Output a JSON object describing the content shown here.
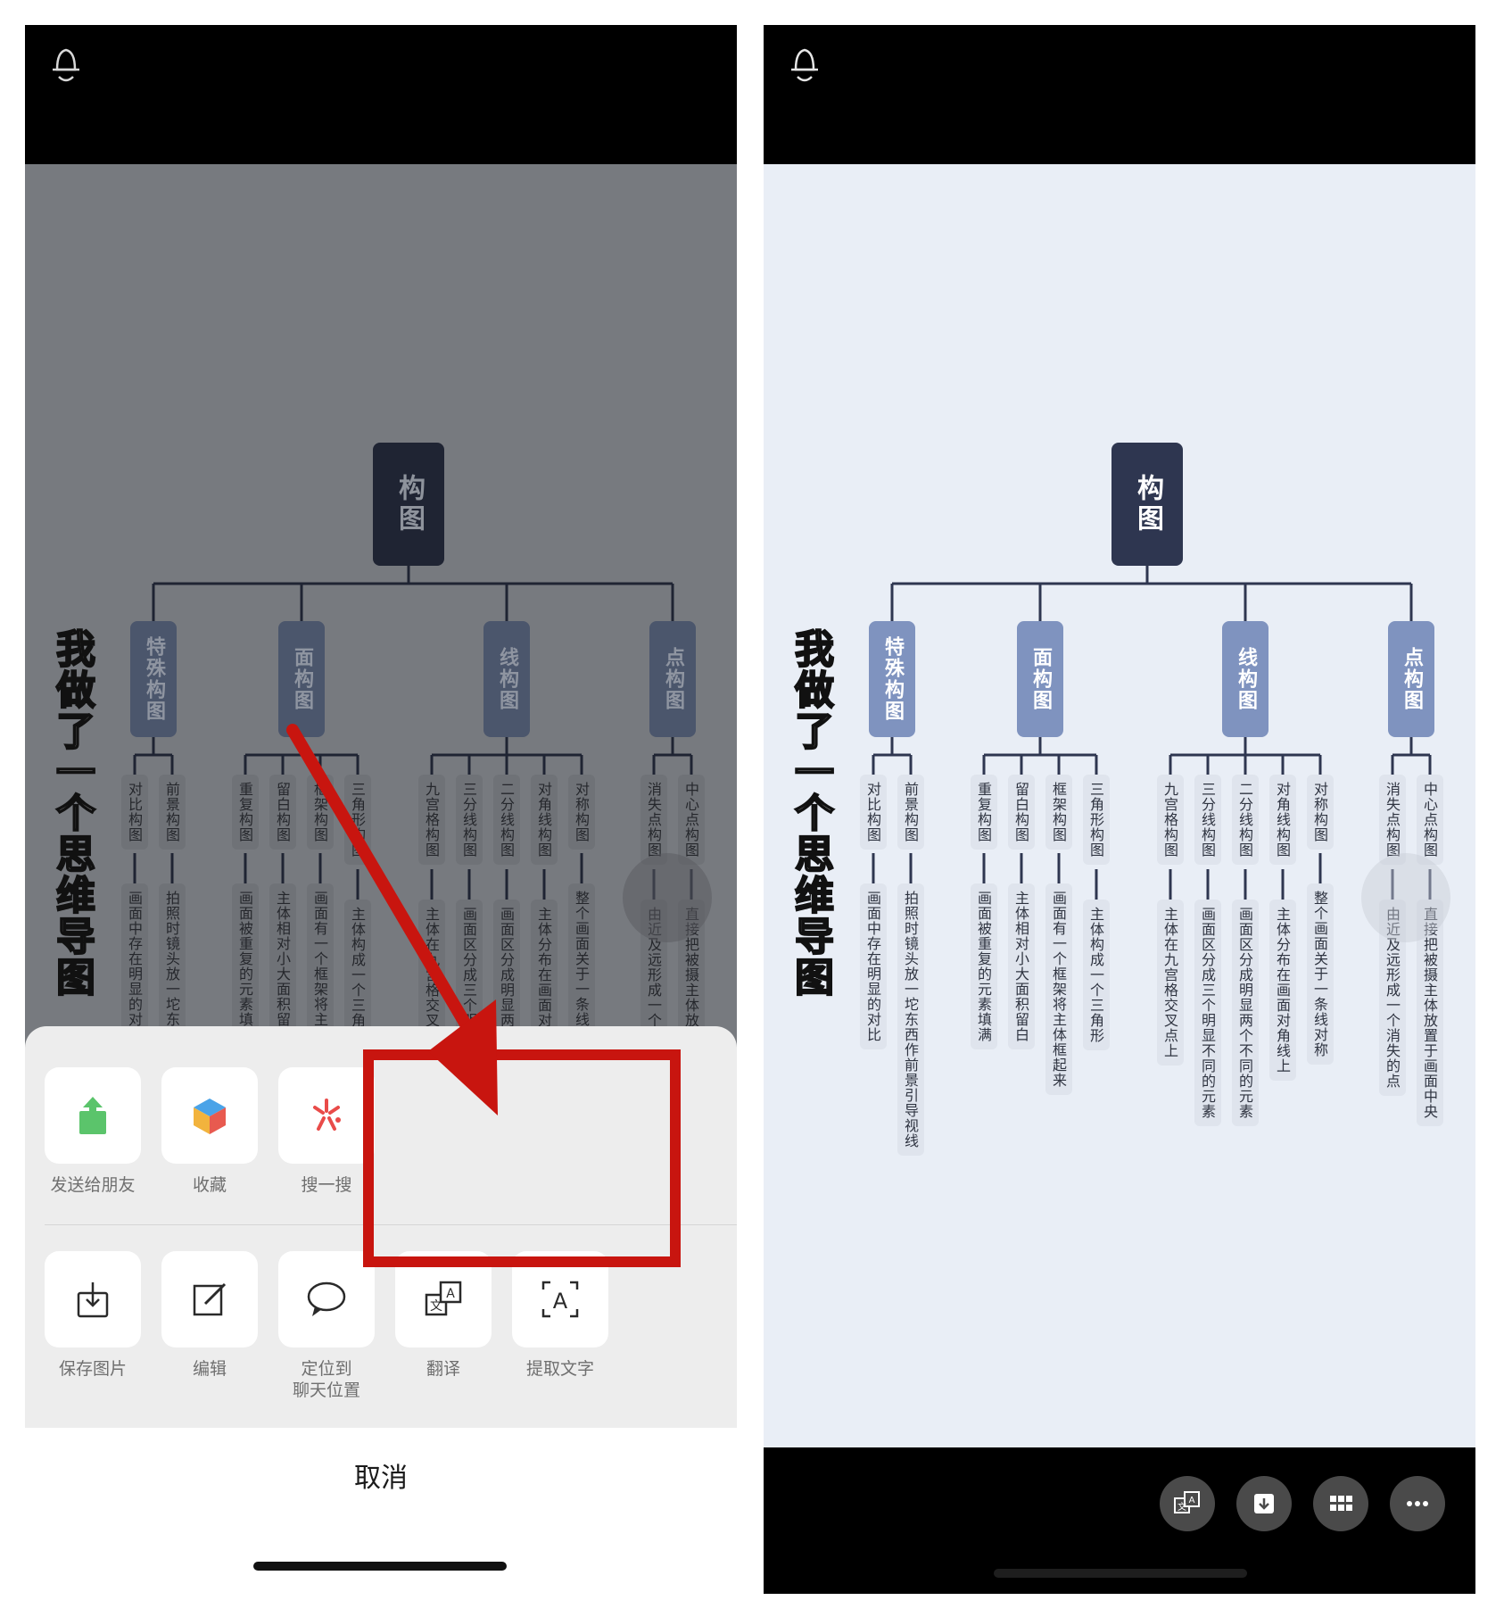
{
  "mindmap": {
    "root": "构图",
    "title": "我做了一个思维导图",
    "branches": [
      {
        "label": "特殊构图",
        "leaves": [
          {
            "label": "对比构图",
            "detail": "画面中存在明显的对比"
          },
          {
            "label": "前景构图",
            "detail": "拍照时镜头放一坨东西作前景引导视线"
          }
        ]
      },
      {
        "label": "面构图",
        "leaves": [
          {
            "label": "重复构图",
            "detail": "画面被重复的元素填满"
          },
          {
            "label": "留白构图",
            "detail": "主体相对小大面积留白"
          },
          {
            "label": "框架构图",
            "detail": "画面有一个框架将主体框起来"
          },
          {
            "label": "三角形构图",
            "detail": "主体构成一个三角形"
          }
        ]
      },
      {
        "label": "线构图",
        "leaves": [
          {
            "label": "九宫格构图",
            "detail": "主体在九宫格交叉点上"
          },
          {
            "label": "三分线构图",
            "detail": "画面区分成三个明显不同的元素"
          },
          {
            "label": "二分线构图",
            "detail": "画面区分成明显两个不同的元素"
          },
          {
            "label": "对角线构图",
            "detail": "主体分布在画面对角线上"
          },
          {
            "label": "对称构图",
            "detail": "整个画面关于一条线对称"
          }
        ]
      },
      {
        "label": "点构图",
        "leaves": [
          {
            "label": "消失点构图",
            "detail": "由近及远形成一个消失的点"
          },
          {
            "label": "中心点构图",
            "detail": "直接把被摄主体放置于画面中央"
          }
        ]
      }
    ]
  },
  "share_sheet": {
    "row1": [
      {
        "label": "发送给朋友",
        "icon": "share-upload-icon"
      },
      {
        "label": "收藏",
        "icon": "favorites-cube-icon"
      },
      {
        "label": "搜一搜",
        "icon": "search-spark-icon"
      }
    ],
    "row2": [
      {
        "label": "保存图片",
        "icon": "download-icon"
      },
      {
        "label": "编辑",
        "icon": "edit-icon"
      },
      {
        "label": "定位到\n聊天位置",
        "icon": "chat-bubble-icon"
      },
      {
        "label": "翻译",
        "icon": "translate-icon"
      },
      {
        "label": "提取文字",
        "icon": "extract-text-icon"
      }
    ],
    "cancel": "取消"
  },
  "viewer_toolbar": {
    "buttons": [
      "translate-icon",
      "download-icon",
      "grid-icon",
      "more-icon"
    ]
  },
  "colors": {
    "highlight": "#c8150f",
    "root_node": "#2e3650",
    "branch_node": "#7f93bf",
    "canvas": "#e9eef6",
    "dimmed_canvas": "#777a7f"
  }
}
